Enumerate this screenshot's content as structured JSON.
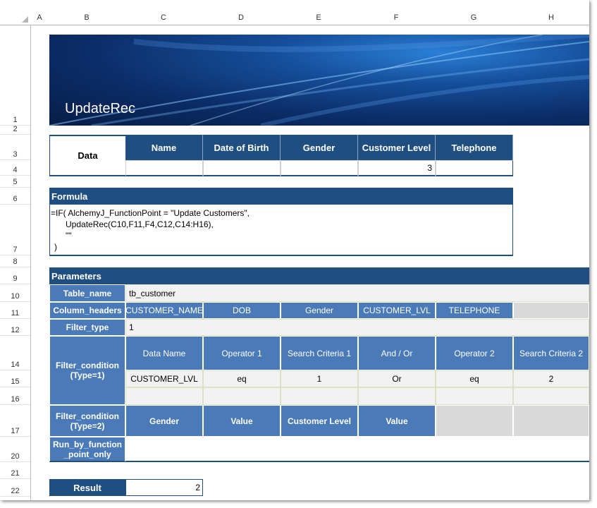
{
  "columns": [
    "A",
    "B",
    "C",
    "D",
    "E",
    "F",
    "G",
    "H"
  ],
  "rows": [
    "1",
    "2",
    "3",
    "4",
    "5",
    "6",
    "7",
    "8",
    "9",
    "10",
    "11",
    "12",
    "14",
    "15",
    "16",
    "17",
    "20",
    "21",
    "22"
  ],
  "banner": {
    "title": "UpdateRec"
  },
  "data_section": {
    "label": "Data",
    "headers": [
      "Name",
      "Date of Birth",
      "Gender",
      "Customer Level",
      "Telephone"
    ],
    "values": [
      "",
      "",
      "",
      "3",
      ""
    ]
  },
  "formula_section": {
    "header": "Formula",
    "lines": [
      "=IF( AlchemyJ_FunctionPoint = \"Update Customers\",",
      "UpdateRec(C10,F11,F4,C12,C14:H16),",
      "\"\"",
      ")"
    ]
  },
  "parameters": {
    "header": "Parameters",
    "table_name_label": "Table_name",
    "table_name_value": "tb_customer",
    "column_headers_label": "Column_headers",
    "column_headers": [
      "CUSTOMER_NAME",
      "DOB",
      "Gender",
      "CUSTOMER_LVL",
      "TELEPHONE"
    ],
    "filter_type_label": "Filter_type",
    "filter_type_value": "1",
    "filter_condition_1_label": "Filter_condition\n(Type=1)",
    "filter_condition_1_headers": [
      "Data Name",
      "Operator 1",
      "Search Criteria 1",
      "And / Or",
      "Operator 2",
      "Search Criteria 2"
    ],
    "filter_condition_1_row": [
      "CUSTOMER_LVL",
      "eq",
      "1",
      "Or",
      "eq",
      "2"
    ],
    "filter_condition_2_label": "Filter_condition\n(Type=2)",
    "filter_condition_2_headers": [
      "Gender",
      "Value",
      "Customer Level",
      "Value"
    ],
    "run_by_label": "Run_by_function\n_point_only"
  },
  "result": {
    "label": "Result",
    "value": "2"
  }
}
